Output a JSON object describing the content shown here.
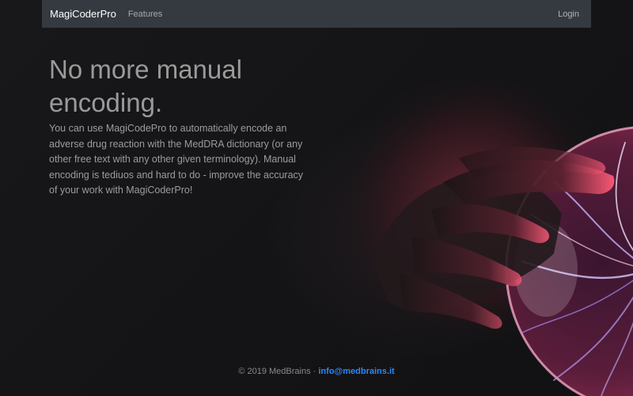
{
  "navbar": {
    "brand": "MagiCoderPro",
    "links": [
      {
        "label": "Features"
      }
    ],
    "login_label": "Login"
  },
  "hero": {
    "title": "No more manual encoding.",
    "lead": "You can use MagiCodePro to automatically encode an adverse drug reaction with the MedDRA dictionary (or any other free text with any other given terminology). Manual encoding is tediuos and hard to do - improve the accuracy of your work with MagiCoderPro!"
  },
  "footer": {
    "copyright": "© 2019 MedBrains",
    "separator": " · ",
    "email": "info@medbrains.it"
  },
  "colors": {
    "navbar_bg": "#343a40",
    "page_bg": "#141416",
    "link_accent": "#2f86f6",
    "plasma_pink": "#e8507a",
    "plasma_violet": "#b9a0ff"
  }
}
